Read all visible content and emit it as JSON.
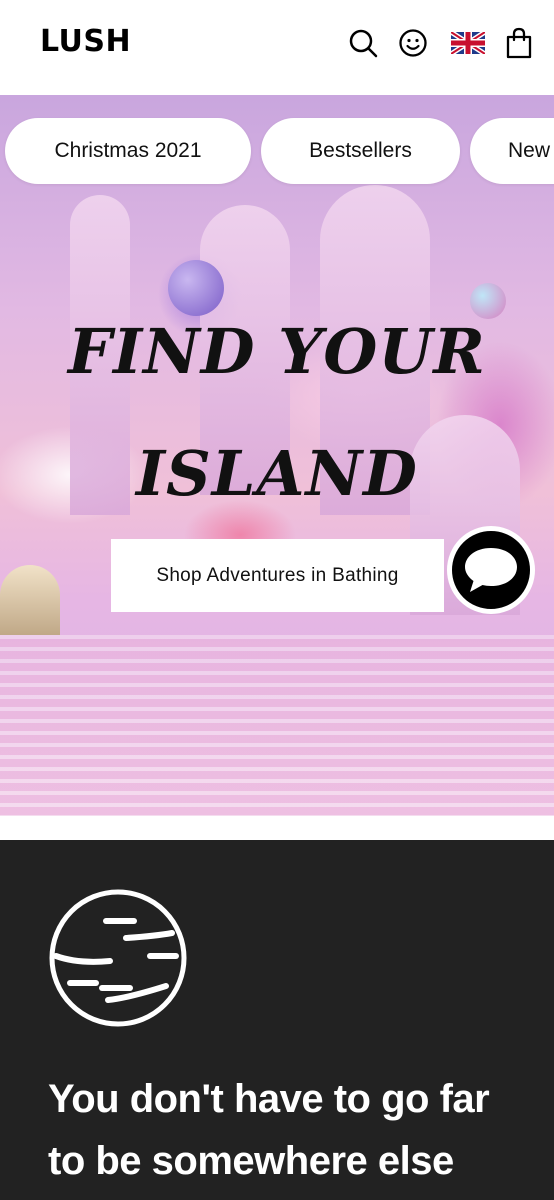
{
  "header": {
    "logo": "LUSH",
    "icons": [
      "search-icon",
      "account-icon",
      "uk-flag-icon",
      "bag-icon"
    ]
  },
  "nav_pills": [
    {
      "label": "Christmas 2021"
    },
    {
      "label": "Bestsellers"
    },
    {
      "label": "New"
    }
  ],
  "hero": {
    "headline_line1": "FIND YOUR",
    "headline_line2": "ISLAND",
    "cta_label": "Shop Adventures in Bathing"
  },
  "chat": {
    "icon": "chat-bubble-icon"
  },
  "promo": {
    "icon": "globe-icon",
    "line1": "You don't have to go far",
    "line2": "to be somewhere else"
  },
  "colors": {
    "dark_section": "#222222",
    "hero_pink": "#e2b9e3"
  }
}
